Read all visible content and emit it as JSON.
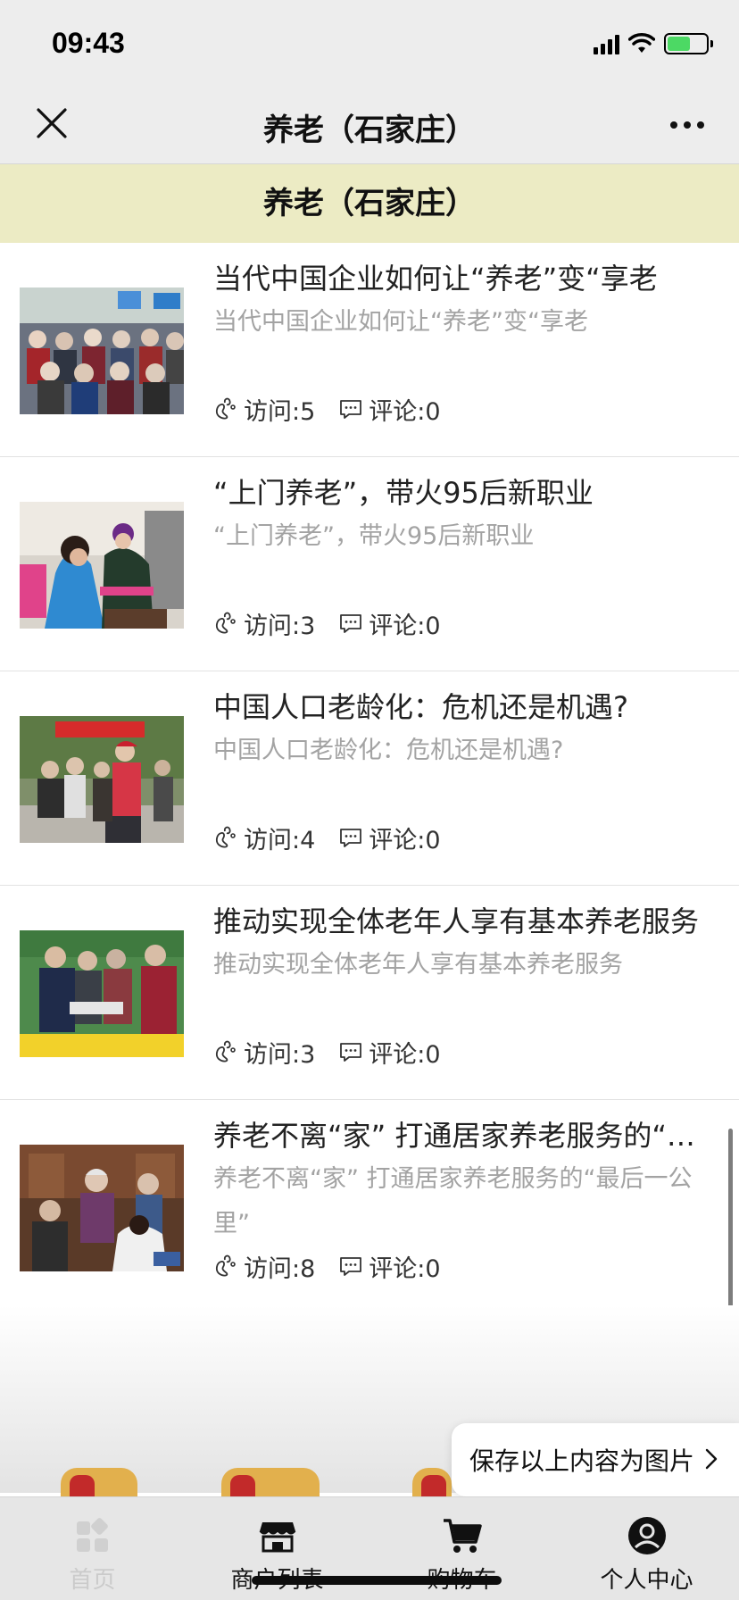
{
  "status_bar": {
    "time": "09:43",
    "icons": [
      "cellular-signal-icon",
      "wifi-icon",
      "battery-charging-icon"
    ]
  },
  "nav": {
    "title": "养老（石家庄）",
    "close_icon": "close-icon",
    "more_icon": "more-dots-icon"
  },
  "section": {
    "title": "养老（石家庄）"
  },
  "articles": [
    {
      "title": "当代中国企业如何让“养老”变“享老",
      "summary": "当代中国企业如何让“养老”变“享老",
      "visits": "访问:5",
      "comments": "评论:0"
    },
    {
      "title": "“上门养老”，带火95后新职业",
      "summary": "“上门养老”，带火95后新职业",
      "visits": "访问:3",
      "comments": "评论:0"
    },
    {
      "title": "中国人口老龄化：危机还是机遇?",
      "summary": "中国人口老龄化：危机还是机遇?",
      "visits": "访问:4",
      "comments": "评论:0"
    },
    {
      "title": "推动实现全体老年人享有基本养老服务",
      "summary": "推动实现全体老年人享有基本养老服务",
      "visits": "访问:3",
      "comments": "评论:0"
    },
    {
      "title": "养老不离“家” 打通居家养老服务的“…",
      "summary": "养老不离“家” 打通居家养老服务的“最后一公里”",
      "visits": "访问:8",
      "comments": "评论:0"
    }
  ],
  "meta_icons": {
    "visits": "footprint-icon",
    "comments": "comment-bubble-icon"
  },
  "save_button": {
    "label": "保存以上内容为图片"
  },
  "tabs": [
    {
      "label": "首页",
      "icon": "home-grid-icon",
      "active": true
    },
    {
      "label": "商户列表",
      "icon": "store-icon",
      "active": false
    },
    {
      "label": "购物车",
      "icon": "cart-icon",
      "active": false
    },
    {
      "label": "个人中心",
      "icon": "user-icon",
      "active": false
    }
  ],
  "colors": {
    "banner": "#ecebc4",
    "nav_background": "#ededed",
    "summary_text": "#a3a3a3",
    "tab_active": "#cbcbcb"
  }
}
